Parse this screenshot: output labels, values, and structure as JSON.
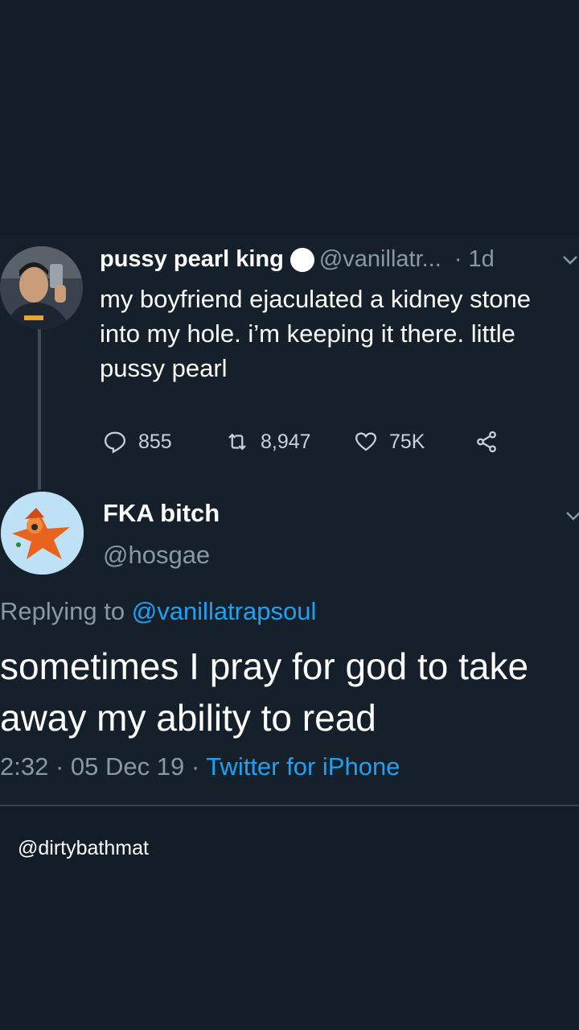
{
  "original_tweet": {
    "display_name": "pussy pearl king",
    "handle": "@vanillatr...",
    "time": "· 1d",
    "text": "my boyfriend ejaculated a kidney stone into my hole. i’m keeping it there. little pussy pearl",
    "replies": "855",
    "retweets": "8,947",
    "likes": "75K"
  },
  "reply_tweet": {
    "display_name": "FKA bitch",
    "handle": "@hosgae",
    "replying_prefix": "Replying to ",
    "replying_to": "@vanillatrapsoul",
    "text": "sometimes I pray for god to take away my ability to read",
    "timestamp": "2:32 · 05 Dec 19 · ",
    "source": "Twitter for iPhone"
  },
  "watermark": "@dirtybathmat",
  "colors": {
    "background": "#131d27",
    "card": "#15202b",
    "secondary_text": "#8899a6",
    "link": "#1da1f2"
  },
  "icons": [
    "reply-icon",
    "retweet-icon",
    "like-icon",
    "share-icon",
    "chevron-down-icon"
  ]
}
